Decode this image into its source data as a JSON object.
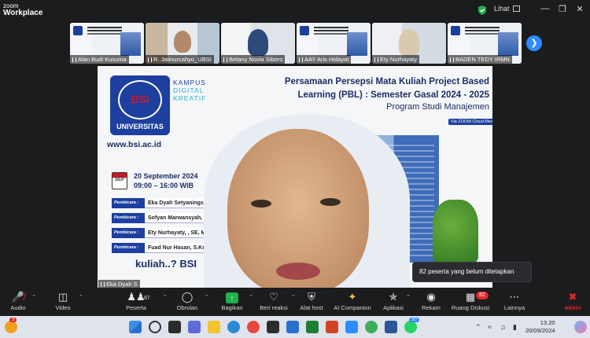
{
  "app": {
    "brand_line1": "zoom",
    "brand_line2": "Workplace",
    "view_label": "Lihat"
  },
  "thumbnails": [
    {
      "name": "Alan Budi Kusuma"
    },
    {
      "name": "R. Jatinurcahyo_UBSI"
    },
    {
      "name": "Betany Novia Siboro"
    },
    {
      "name": "AAY Aris Hidayat"
    },
    {
      "name": "Ety Nurhayaty"
    },
    {
      "name": "BADEN TEDY IRMN"
    }
  ],
  "slide": {
    "kampus": [
      "KAMPUS",
      "DIGITAL",
      "KREATIF"
    ],
    "logo_bsi": "BSI",
    "logo_univ": "UNIVERSITAS",
    "url": "www.bsi.ac.id",
    "title_line1": "Persamaan Persepsi Mata Kuliah Project Based",
    "title_line2": "Learning (PBL) : Semester Gasal 2024 - 2025",
    "prodi": "Program Studi Manajemen",
    "zoom_tag": "Via ZOOM Cloud Meeting",
    "cal_label": "SEP",
    "date": "20 September 2024",
    "time": "09:00 – 16:00 WIB",
    "speakers": [
      {
        "label": "Pembicara :",
        "name": "Eka Dyah Setyaningsih, SE, M"
      },
      {
        "label": "Pembicara :",
        "name": "Sofyan Marwansyah, SE, MM"
      },
      {
        "label": "Pembicara :",
        "name": "Ety Nurhayaty, , SE, MM."
      },
      {
        "label": "Pembicara :",
        "name": "Fuad Nur Hasan, S.Kom, M"
      }
    ],
    "bottom_text": "kuliah..? BSI"
  },
  "presenter_name": "Eka Dyah S",
  "tooltip": "82 peserta yang belum ditetapkan",
  "toolbar": {
    "audio": "Audio",
    "video": "Video",
    "participants": "Peserta",
    "participants_count": "87",
    "chat": "Obrolan",
    "share": "Bagikan",
    "react": "Beri reaksi",
    "host_tools": "Alat host",
    "ai": "AI Companion",
    "apps": "Aplikasi",
    "record": "Rekam",
    "breakout": "Ruang Diskusi",
    "breakout_badge": "82",
    "more": "Lainnya",
    "end": "Akhiri"
  },
  "taskbar": {
    "time": "13.20",
    "date": "20/09/2024",
    "badge": "3",
    "wa_badge": "20"
  },
  "colors": {
    "accent": "#2d8cff",
    "danger": "#e02828",
    "share": "#22b24c",
    "brand_blue": "#1d3fa0"
  }
}
